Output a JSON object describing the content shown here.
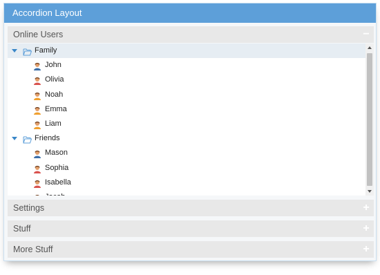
{
  "window": {
    "title": "Accordion Layout"
  },
  "accordion": {
    "online_users": {
      "title": "Online Users",
      "toggle": "−",
      "tree": [
        {
          "type": "group",
          "label": "Family",
          "expanded": true,
          "selected": true
        },
        {
          "type": "user",
          "label": "John",
          "gender": "male"
        },
        {
          "type": "user",
          "label": "Olivia",
          "gender": "female"
        },
        {
          "type": "user",
          "label": "Noah",
          "gender": "male-orange"
        },
        {
          "type": "user",
          "label": "Emma",
          "gender": "male-orange"
        },
        {
          "type": "user",
          "label": "Liam",
          "gender": "male-orange"
        },
        {
          "type": "group",
          "label": "Friends",
          "expanded": true,
          "selected": false
        },
        {
          "type": "user",
          "label": "Mason",
          "gender": "male"
        },
        {
          "type": "user",
          "label": "Sophia",
          "gender": "female"
        },
        {
          "type": "user",
          "label": "Isabella",
          "gender": "female"
        },
        {
          "type": "user",
          "label": "Jacob",
          "gender": "male"
        }
      ]
    },
    "settings": {
      "title": "Settings",
      "toggle": "+"
    },
    "stuff": {
      "title": "Stuff",
      "toggle": "+"
    },
    "more_stuff": {
      "title": "More Stuff",
      "toggle": "+"
    }
  },
  "colors": {
    "header": "#5d9fd9",
    "accordion_header": "#e8e8e8",
    "selected_row": "#e6edf3",
    "folder_icon": "#5d9fd9"
  }
}
